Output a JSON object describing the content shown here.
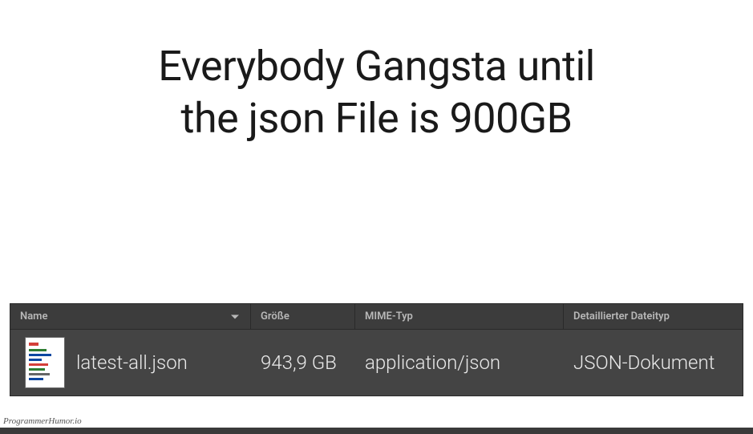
{
  "caption_line1": "Everybody Gangsta until",
  "caption_line2": "the json File is 900GB",
  "columns": {
    "name": "Name",
    "size": "Größe",
    "mime": "MIME-Typ",
    "detail": "Detaillierter Dateityp"
  },
  "row": {
    "filename": "latest-all.json",
    "size": "943,9 GB",
    "mime": "application/json",
    "detail": "JSON-Dokument"
  },
  "watermark": "ProgrammerHumor.io"
}
